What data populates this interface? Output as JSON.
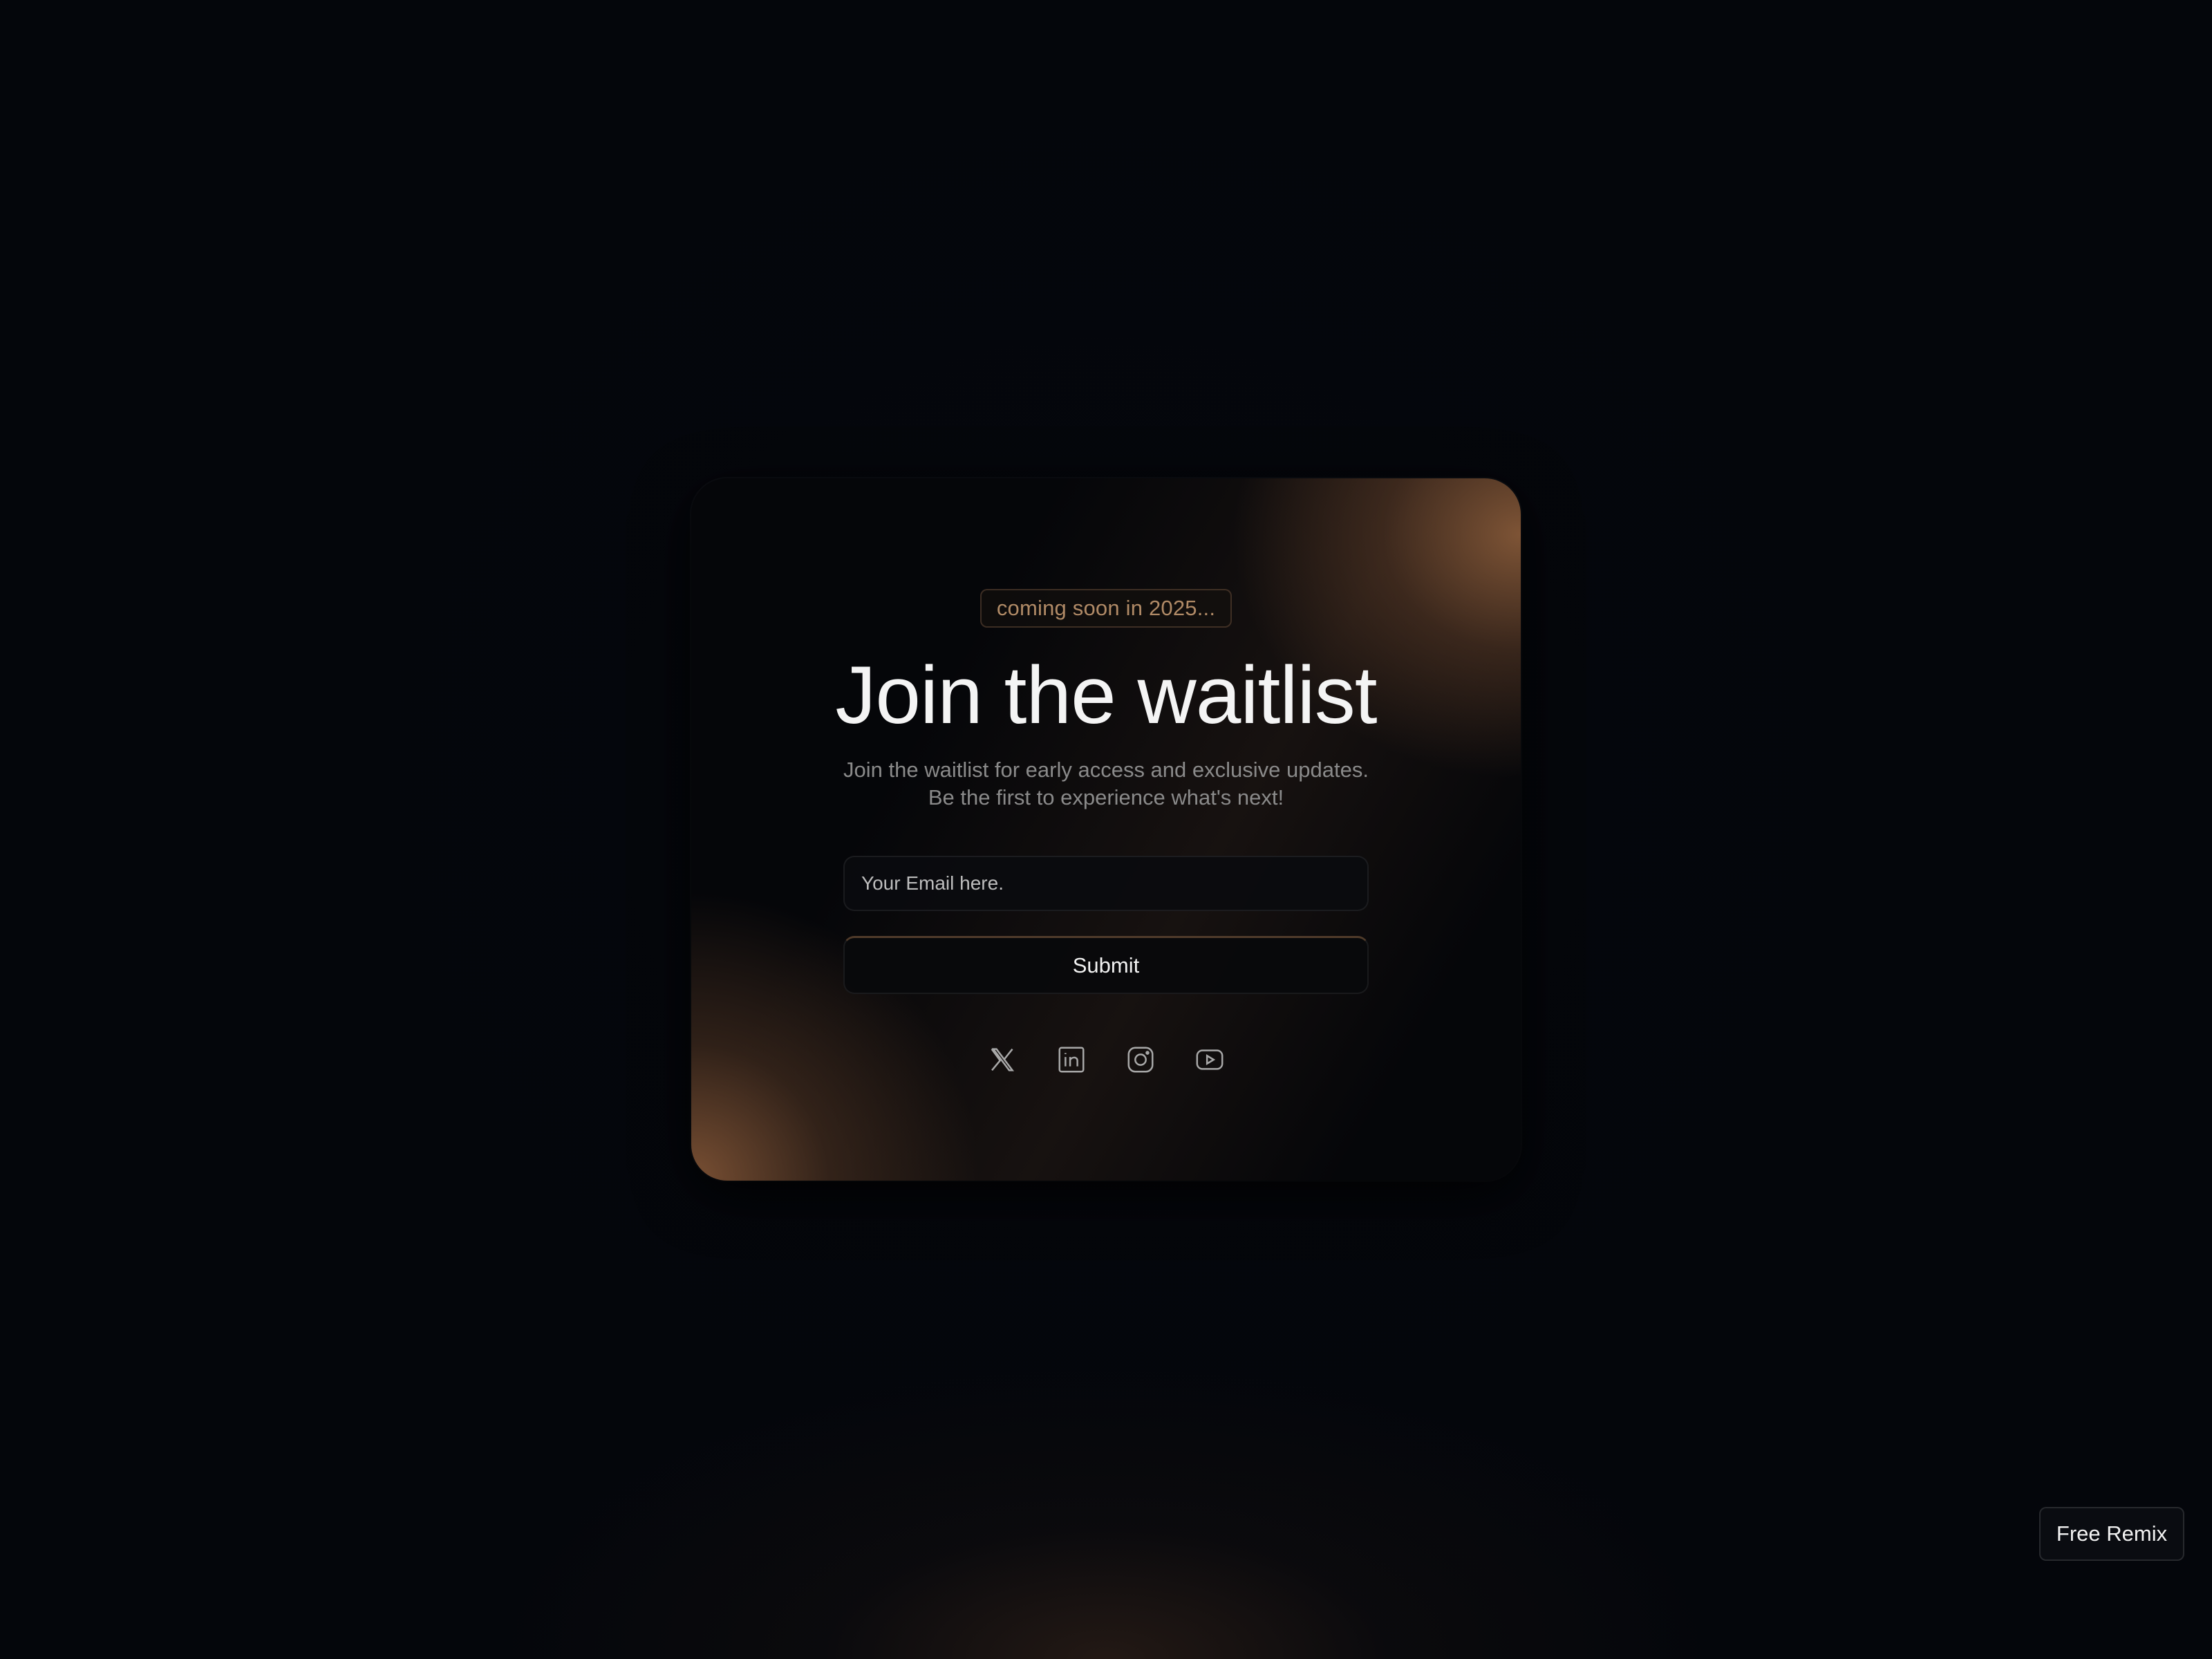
{
  "card": {
    "badge": "coming soon in 2025...",
    "title": "Join the waitlist",
    "subtitle_line1": "Join the waitlist for early access and exclusive updates.",
    "subtitle_line2": "Be the first to experience what's next!",
    "email_placeholder": "Your Email here.",
    "submit_label": "Submit"
  },
  "socials": [
    {
      "icon": "x-icon"
    },
    {
      "icon": "linkedin-icon"
    },
    {
      "icon": "instagram-icon"
    },
    {
      "icon": "youtube-icon"
    }
  ],
  "remix_label": "Free Remix",
  "colors": {
    "background": "#04060b",
    "accent": "#b08a66",
    "glow": "#845838"
  }
}
